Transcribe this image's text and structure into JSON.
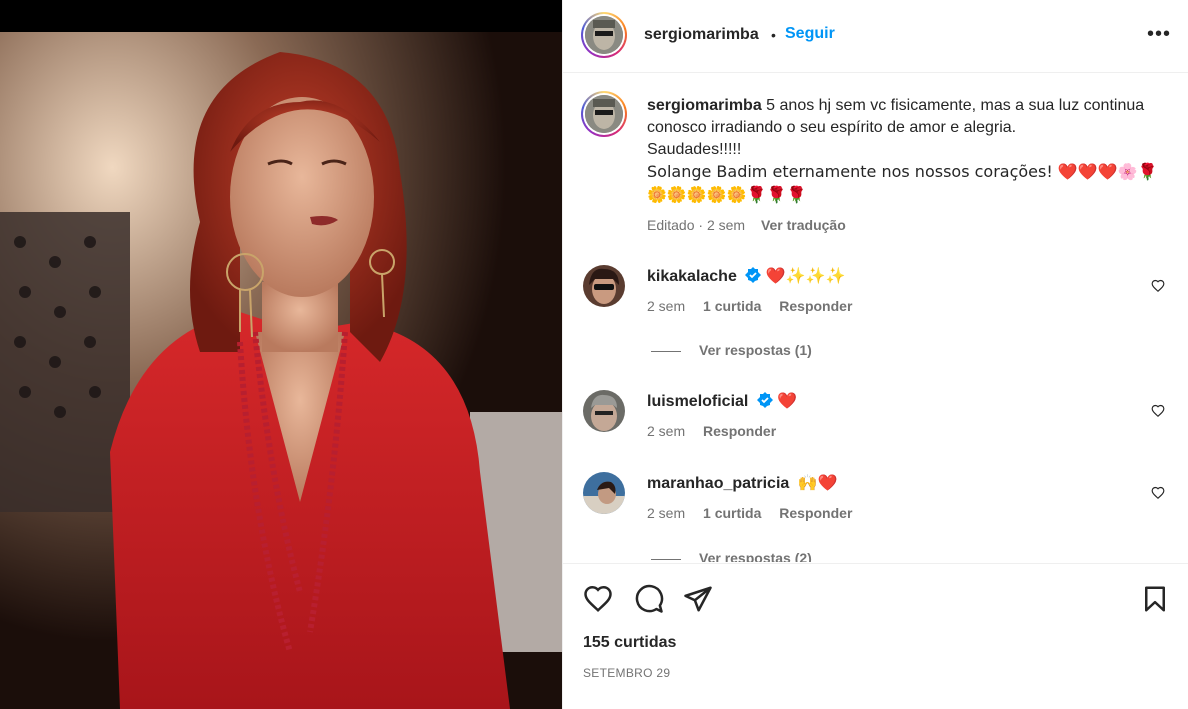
{
  "post": {
    "username": "sergiomarimba",
    "dot": "•",
    "follow_label": "Seguir",
    "more_label": "•••"
  },
  "caption": {
    "username": "sergiomarimba",
    "text_line1": "5 anos hj sem vc fisicamente, mas a sua luz continua conosco irradiando o seu espírito de amor e alegria.",
    "text_line2": "Saudades!!!!!",
    "text_line3": "Solange Badim eternamente nos nossos corações! ❤️❤️❤️🌸🌹",
    "text_line4": "🌼🌼🌼🌼🌼🌹🌹🌹",
    "edited": "Editado",
    "time": "2 sem",
    "translate": "Ver tradução"
  },
  "comments": [
    {
      "username": "kikakalache",
      "verified": true,
      "text": "❤️✨✨✨",
      "time": "2 sem",
      "likes": "1 curtida",
      "reply": "Responder",
      "view_replies": "Ver respostas (1)"
    },
    {
      "username": "luismeloficial",
      "verified": true,
      "text": "❤️",
      "time": "2 sem",
      "reply": "Responder"
    },
    {
      "username": "maranhao_patricia",
      "verified": false,
      "text": "🙌❤️",
      "time": "2 sem",
      "likes": "1 curtida",
      "reply": "Responder",
      "view_replies": "Ver respostas (2)"
    }
  ],
  "footer": {
    "likes": "155 curtidas",
    "date": "SETEMBRO 29"
  },
  "icons": {
    "like": "heart-icon",
    "comment": "comment-icon",
    "share": "share-icon",
    "save": "bookmark-icon",
    "verified": "verified-badge-icon"
  },
  "colors": {
    "accent": "#0095f6",
    "text": "#262626",
    "secondary": "#737373",
    "verified": "#0095f6",
    "heart": "#ed4956"
  }
}
